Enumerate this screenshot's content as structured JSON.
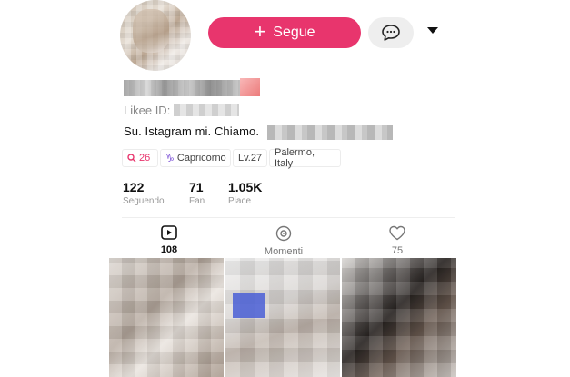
{
  "header": {
    "follow_label": "Segue",
    "follow_icon": "plus-icon",
    "message_icon": "chat-bubble-icon",
    "dropdown_icon": "caret-down-icon",
    "accent_color": "#e8356d"
  },
  "profile": {
    "likee_id_label": "Likee ID:",
    "bio": "Su. Istagram  mi. Chiamo.",
    "tags": {
      "search_count": "26",
      "zodiac": "Capricorno",
      "level": "Lv.27",
      "location": "Palermo, Italy"
    }
  },
  "stats": [
    {
      "value": "122",
      "label": "Seguendo"
    },
    {
      "value": "71",
      "label": "Fan"
    },
    {
      "value": "1.05K",
      "label": "Piace"
    }
  ],
  "tabs": [
    {
      "label": "108",
      "icon": "play-icon",
      "active": true
    },
    {
      "label": "Momenti",
      "icon": "moments-icon",
      "active": false
    },
    {
      "label": "75",
      "icon": "heart-icon",
      "active": false
    }
  ]
}
